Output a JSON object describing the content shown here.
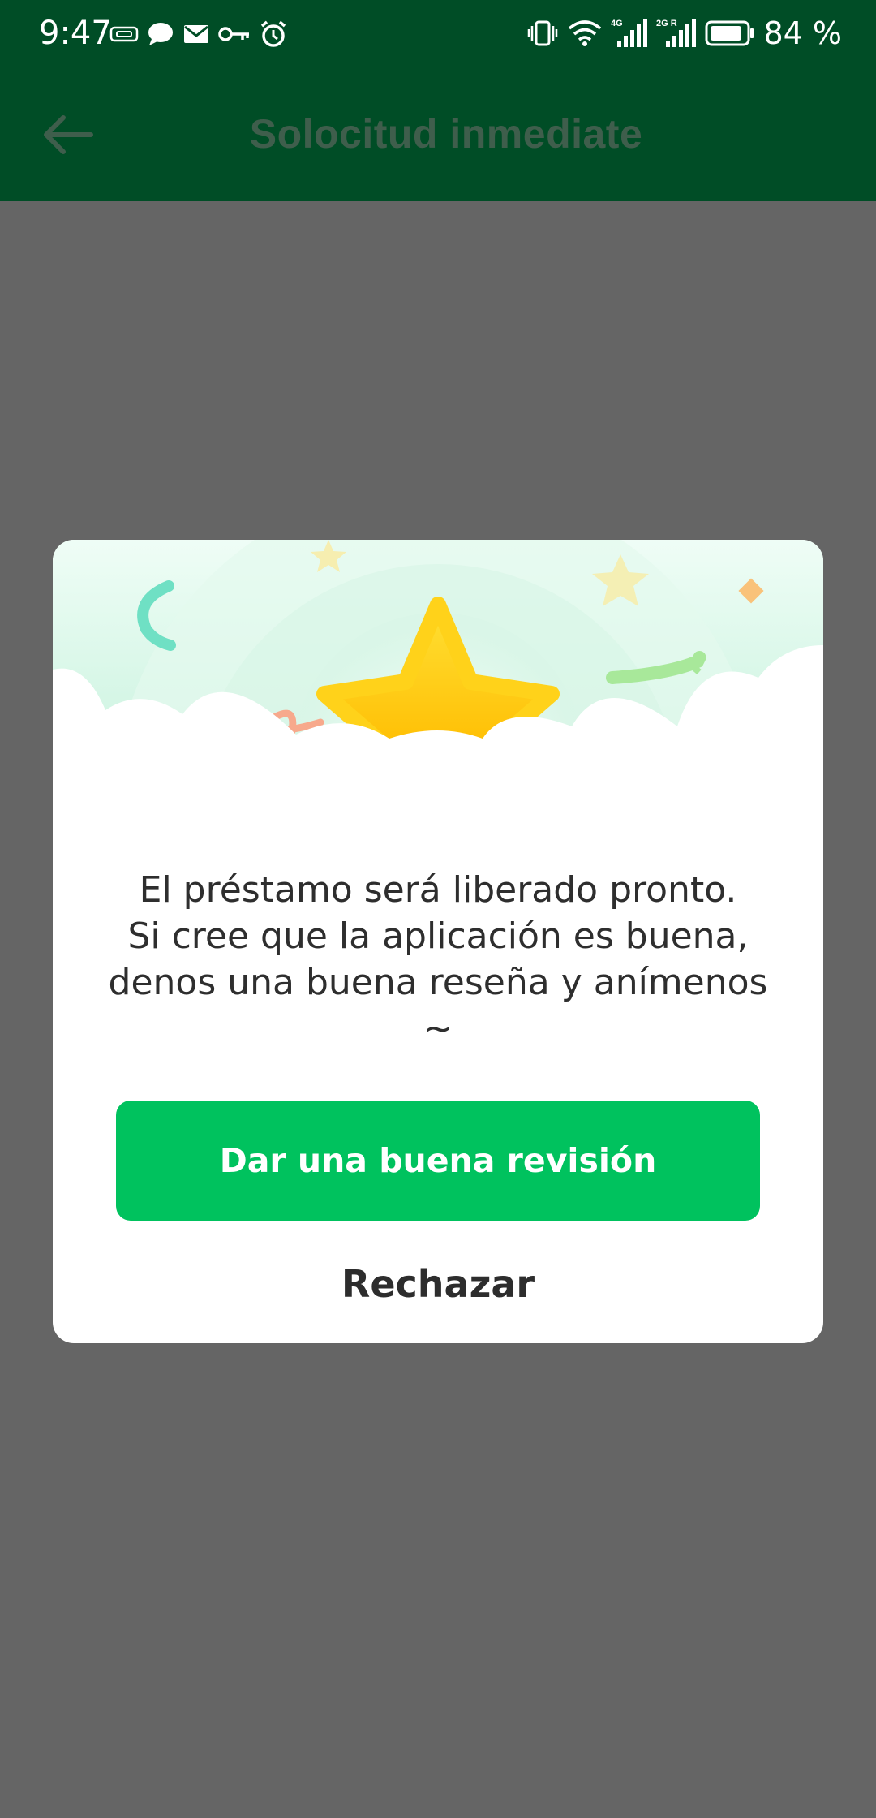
{
  "status_bar": {
    "time": "9:47",
    "battery_text": "84 %",
    "network_1": "4G",
    "network_2": "2G R",
    "icons": [
      "vpn-icon",
      "chat-icon",
      "mail-icon",
      "key-icon",
      "alarm-icon",
      "vibrate-icon",
      "wifi-icon",
      "signal-icon",
      "signal-icon",
      "battery-icon"
    ]
  },
  "app_bar": {
    "title": "Solocitud inmediate",
    "back_icon": "arrow-left-icon"
  },
  "dialog": {
    "illustration": "star-celebration-illustration",
    "message_lines": [
      "El préstamo será liberado pronto.",
      "Si cree que la aplicación es buena,",
      "denos una buena reseña y anímenos",
      "~"
    ],
    "primary_button": "Dar una buena revisión",
    "secondary_button": "Rechazar",
    "colors": {
      "primary": "#00c25e",
      "header_green": "#004d26",
      "overlay": "#656565"
    }
  }
}
